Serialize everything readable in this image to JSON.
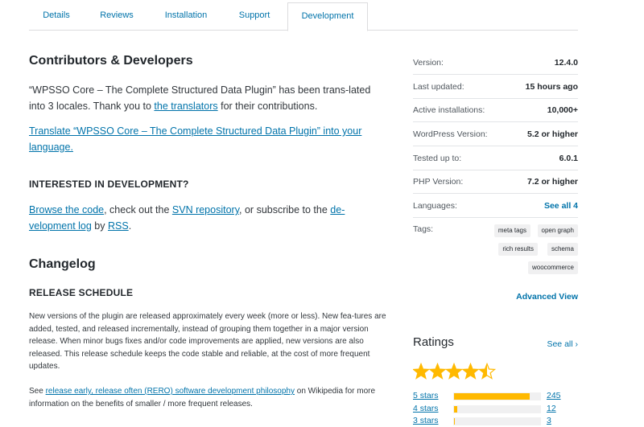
{
  "tabs": [
    {
      "label": "Details"
    },
    {
      "label": "Reviews"
    },
    {
      "label": "Installation"
    },
    {
      "label": "Support"
    },
    {
      "label": "Development",
      "active": true
    }
  ],
  "main": {
    "contributors_title": "Contributors & Developers",
    "translated_text": "“WPSSO Core – The Complete Structured Data Plugin” has been trans-lated into 3 locales. Thank you to ",
    "translators_link": "the translators",
    "translated_text_end": " for their contributions.",
    "translate_link_line1": "Translate “WPSSO Core – The Complete Structured Data Plugin” into your",
    "translate_link_line2": "language.",
    "dev_title": "INTERESTED IN DEVELOPMENT?",
    "browse_code_link": "Browse the code",
    "dev_text_1": ", check out the ",
    "svn_link": "SVN repository",
    "dev_text_2": ", or subscribe to the ",
    "dev_log_link_1": "de-",
    "dev_log_link_2": "velopment log",
    "dev_text_3": " by ",
    "rss_link": "RSS",
    "dev_text_4": ".",
    "changelog_title": "Changelog",
    "release_title": "RELEASE SCHEDULE",
    "release_para": "New versions of the plugin are released approximately every week (more or less). New fea-tures are added, tested, and released incrementally, instead of grouping them together in a major version release. When minor bugs fixes and/or code improvements are applied, new versions are also released. This release schedule keeps the code stable and reliable, at the cost of more frequent updates.",
    "see_text": "See ",
    "rero_link": "release early, release often (RERO) software development philosophy",
    "rero_text": " on Wikipedia for more information on the benefits of smaller / more frequent releases."
  },
  "sidebar": {
    "meta": [
      {
        "label": "Version:",
        "value": "12.4.0"
      },
      {
        "label": "Last updated:",
        "value": "15 hours ago"
      },
      {
        "label": "Active installations:",
        "value": "10,000+"
      },
      {
        "label": "WordPress Version:",
        "value": "5.2 or higher"
      },
      {
        "label": "Tested up to:",
        "value": "6.0.1"
      },
      {
        "label": "PHP Version:",
        "value": "7.2 or higher"
      },
      {
        "label": "Languages:",
        "value": "See all 4"
      }
    ],
    "tags_label": "Tags:",
    "tags": [
      "meta tags",
      "open graph",
      "rich results",
      "schema",
      "woocommerce"
    ],
    "advanced_view": "Advanced View",
    "ratings_title": "Ratings",
    "see_all": "See all",
    "rating_stars": 4.5,
    "star_color": "#ffb900",
    "ratings": [
      {
        "label": "5 stars",
        "count": "245",
        "fraction": 0.88
      },
      {
        "label": "4 stars",
        "count": "12",
        "fraction": 0.04
      },
      {
        "label": "3 stars",
        "count": "3",
        "fraction": 0.01
      }
    ]
  },
  "colors": {
    "link": "#0073aa",
    "text": "#32373c",
    "bar_fill": "#ffb900"
  }
}
